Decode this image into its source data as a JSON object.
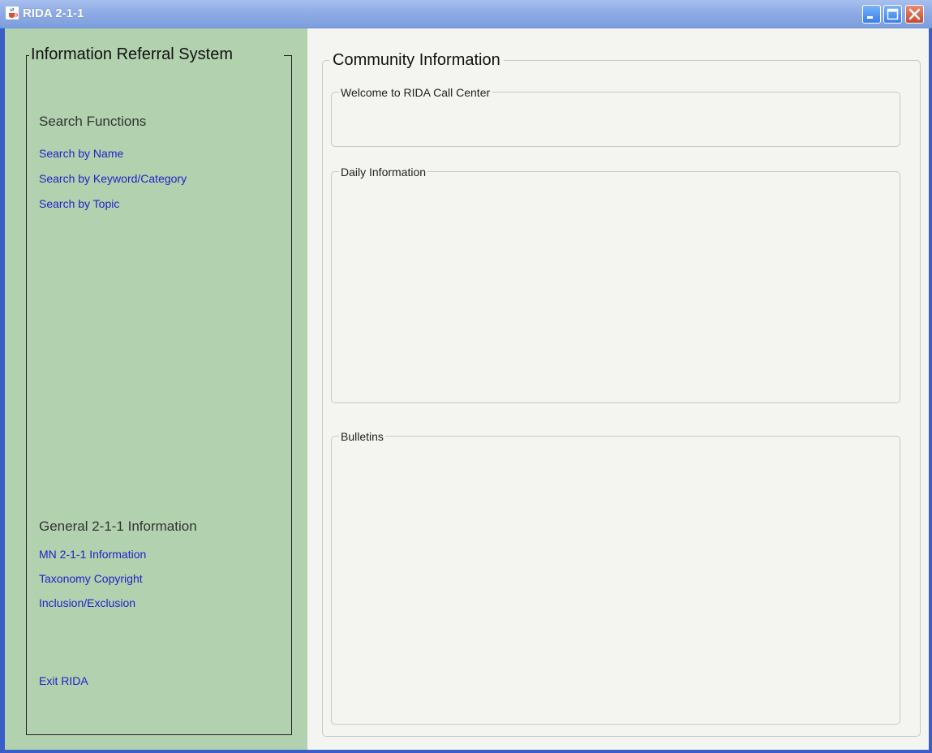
{
  "window": {
    "title": "RIDA 2-1-1",
    "app_icon": "java-cup-icon",
    "controls": [
      "minimize-icon",
      "maximize-icon",
      "close-icon"
    ]
  },
  "sidebar": {
    "title": "Information Referral System",
    "search_section": {
      "heading": "Search Functions",
      "links": [
        "Search by Name",
        "Search by Keyword/Category",
        "Search by Topic"
      ]
    },
    "general_section": {
      "heading": "General 2-1-1 Information",
      "links": [
        "MN 2-1-1 Information",
        "Taxonomy Copyright",
        "Inclusion/Exclusion"
      ]
    },
    "exit_label": "Exit RIDA"
  },
  "main": {
    "title": "Community Information",
    "groups": {
      "welcome": "Welcome to RIDA Call Center",
      "daily": "Daily Information",
      "bulletins": "Bulletins"
    }
  },
  "colors": {
    "sidebar_bg": "#b2d1ae",
    "link": "#2222c8",
    "titlebar": "#8fabe6"
  }
}
